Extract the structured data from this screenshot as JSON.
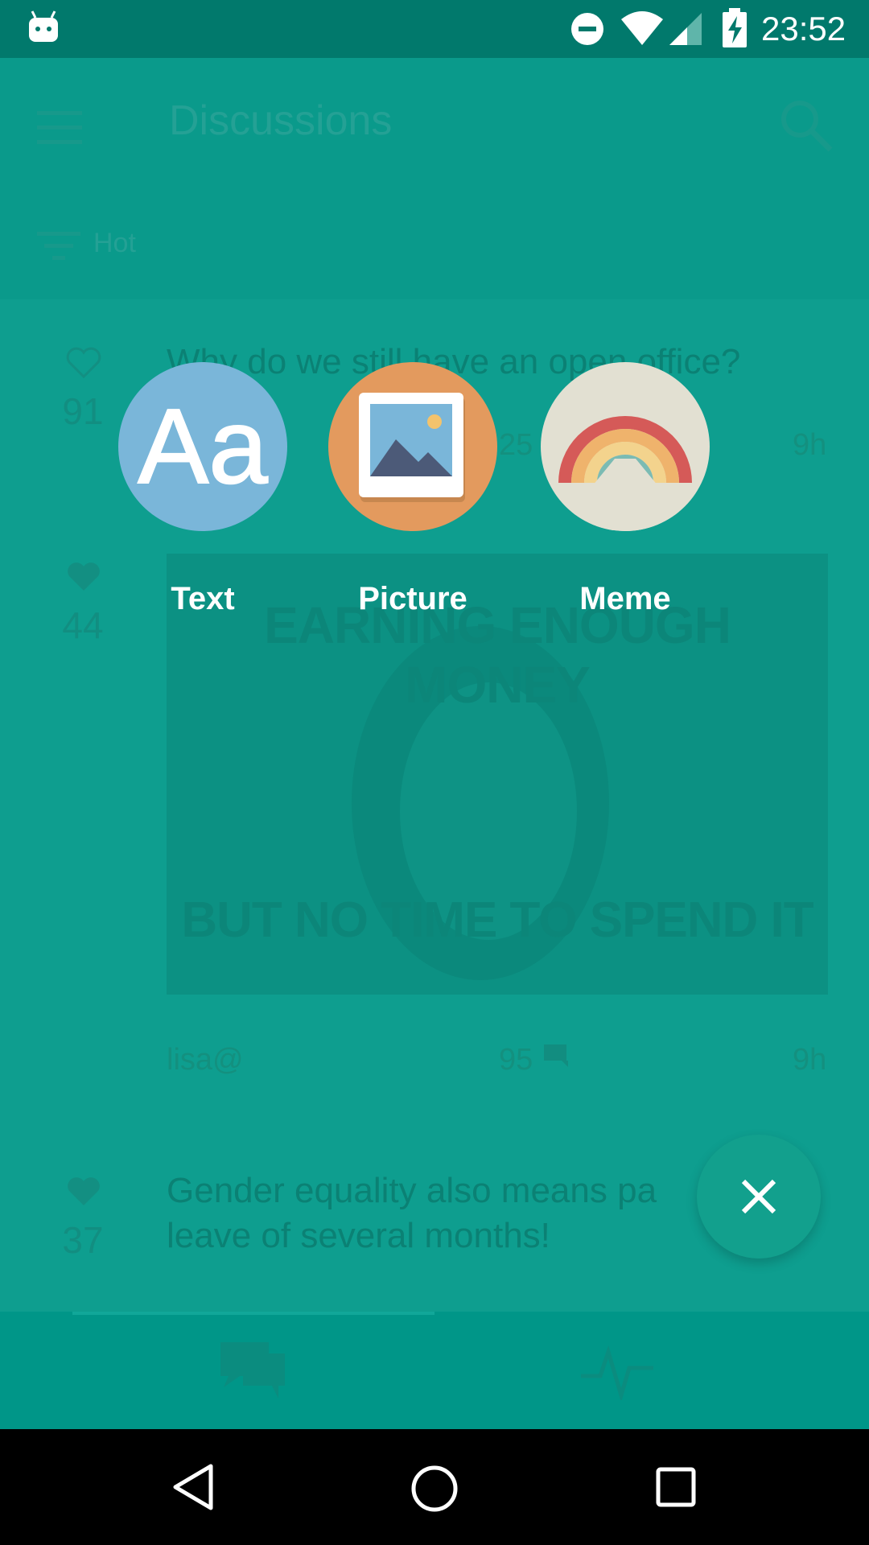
{
  "status_bar": {
    "time": "23:52",
    "icons": [
      "android-icon",
      "do-not-disturb-icon",
      "wifi-icon",
      "cell-signal-icon",
      "battery-charging-icon"
    ]
  },
  "app_bar": {
    "title": "Discussions",
    "sort_label": "Hot"
  },
  "feed": {
    "posts": [
      {
        "votes": "91",
        "title": "Why do we still have an open office?",
        "comments": "25",
        "age": "9h"
      },
      {
        "votes": "44",
        "author": "lisa@",
        "comments": "95",
        "age": "9h",
        "meme_top": "EARNING ENOUGH MONEY",
        "meme_bottom": "BUT NO TIME TO SPEND IT"
      },
      {
        "votes": "37",
        "title": "Gender equality also means pa",
        "title_line2": "leave of several months!"
      }
    ]
  },
  "create_menu": {
    "options": [
      {
        "label": "Text",
        "icon": "text-aa-icon"
      },
      {
        "label": "Picture",
        "icon": "picture-icon"
      },
      {
        "label": "Meme",
        "icon": "rainbow-meme-icon"
      }
    ],
    "close_icon": "close-icon"
  },
  "colors": {
    "primary": "#009688",
    "status_bar": "#01796c",
    "text_option": "#7ab6d9",
    "picture_option": "#e39a5e",
    "meme_option": "#e2e0d2"
  }
}
